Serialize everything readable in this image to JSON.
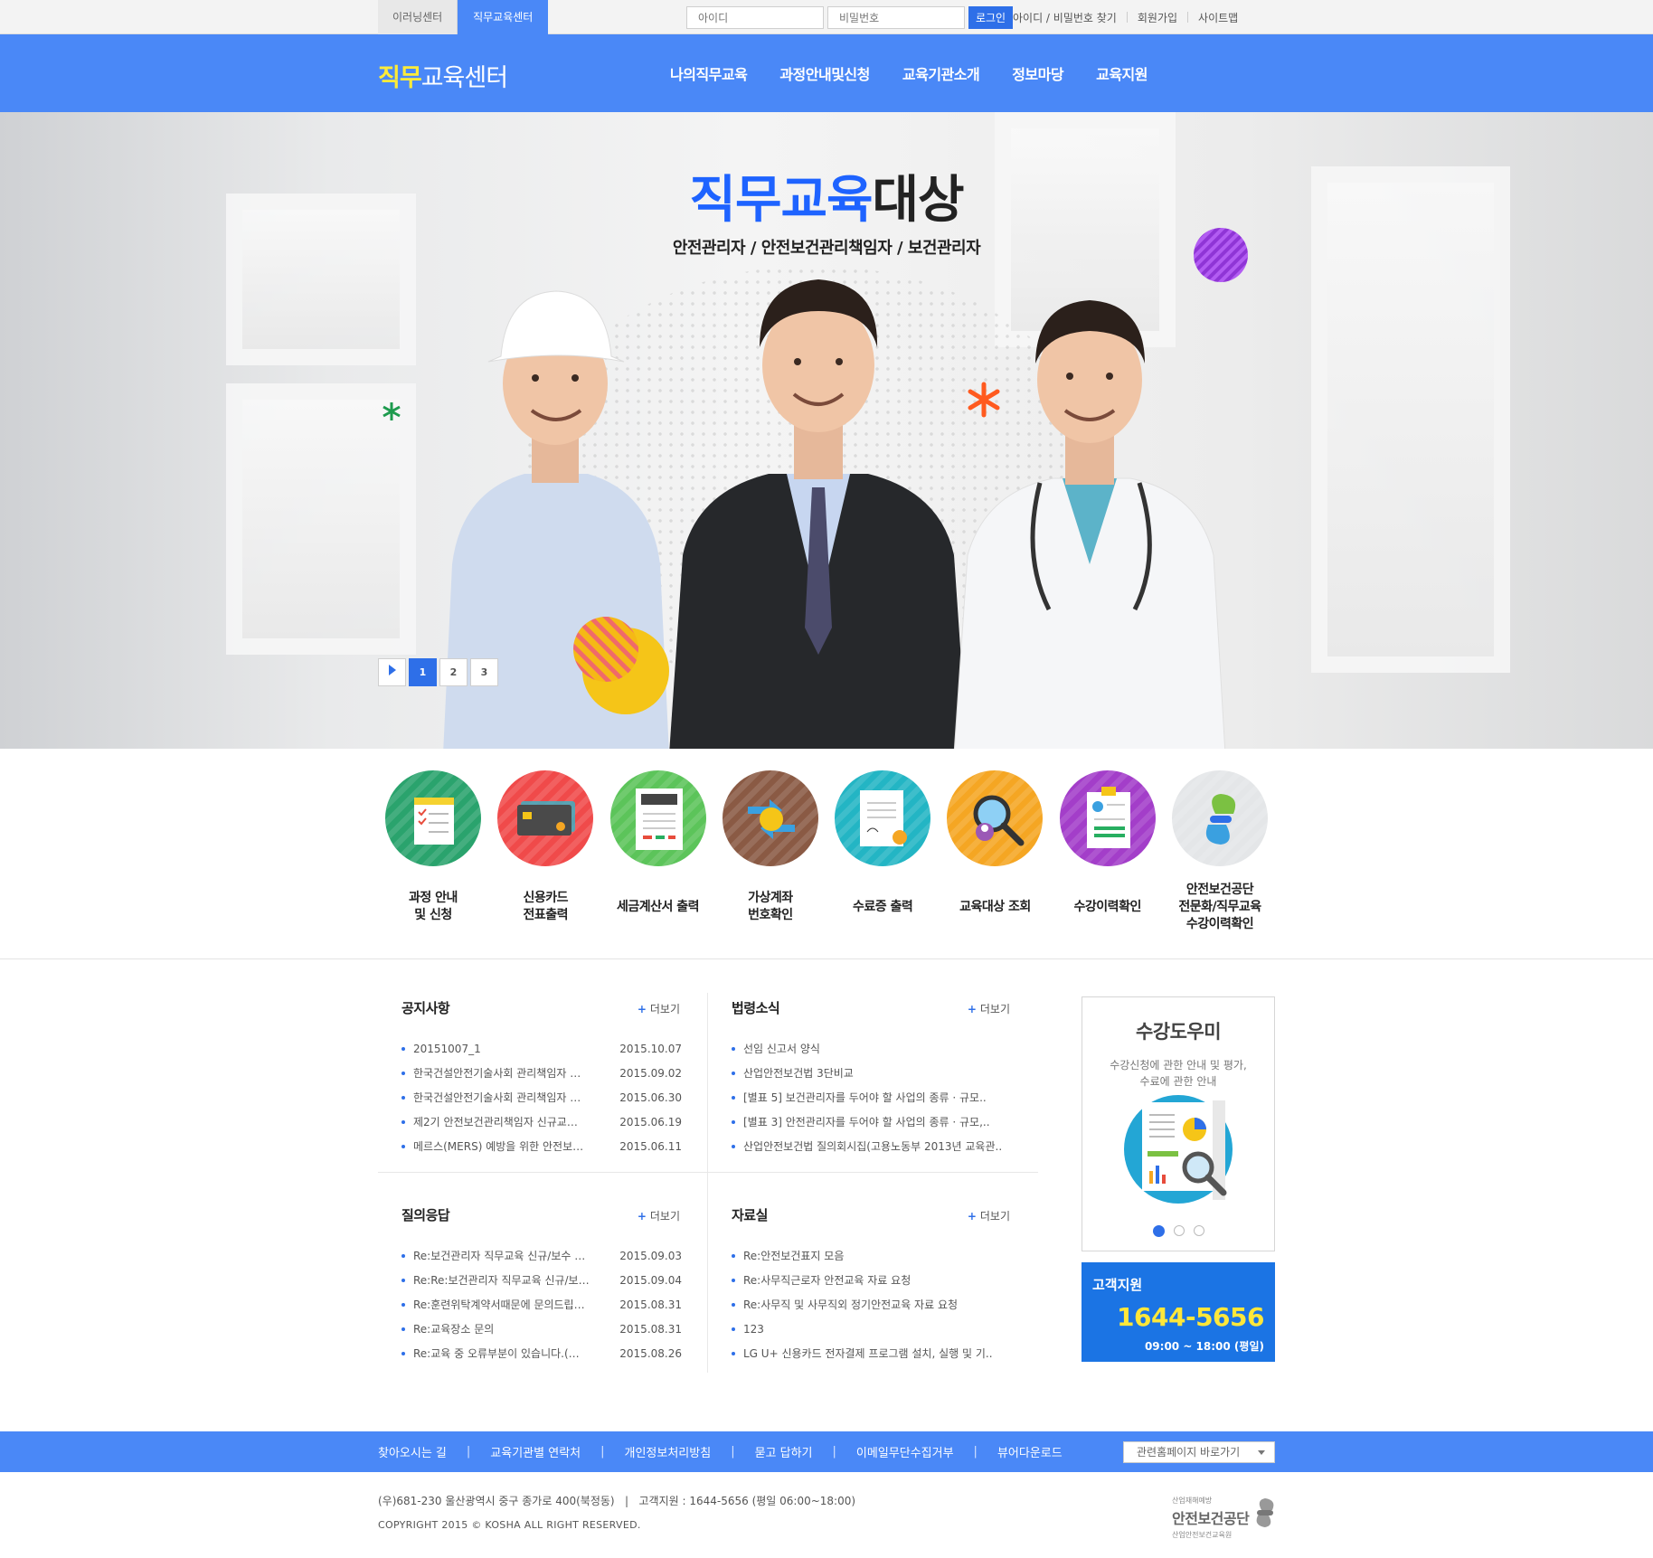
{
  "topbar": {
    "tabs": [
      "이러닝센터",
      "직무교육센터"
    ],
    "id_placeholder": "아이디",
    "pw_placeholder": "비밀번호",
    "login_label": "로그인",
    "links": [
      "아이디 / 비밀번호 찾기",
      "회원가입",
      "사이트맵"
    ]
  },
  "header": {
    "logo_highlight": "직무",
    "logo_rest": "교육센터",
    "nav": [
      "나의직무교육",
      "과정안내및신청",
      "교육기관소개",
      "정보마당",
      "교육지원"
    ],
    "brand_color": "#4a88f7"
  },
  "hero": {
    "title_blue": "직무교육",
    "title_dark": "대상",
    "subtitle": "안전관리자 / 안전보건관리책임자 / 보건관리자",
    "pager": [
      "1",
      "2",
      "3"
    ],
    "active_page": "1"
  },
  "quick_menu": [
    {
      "label": "과정 안내\n및 신청",
      "icon": "calendar-checklist-icon",
      "color": "#2aa36d"
    },
    {
      "label": "신용카드\n전표출력",
      "icon": "credit-card-icon",
      "color": "#f04a4a"
    },
    {
      "label": "세금계산서 출력",
      "icon": "tax-receipt-icon",
      "color": "#5cc45a"
    },
    {
      "label": "가상계좌\n번호확인",
      "icon": "currency-exchange-icon",
      "color": "#8a5a44"
    },
    {
      "label": "수료증 출력",
      "icon": "certificate-icon",
      "color": "#23b5c4"
    },
    {
      "label": "교육대상 조회",
      "icon": "search-person-icon",
      "color": "#f5a623"
    },
    {
      "label": "수강이력확인",
      "icon": "clipboard-icon",
      "color": "#a33ec9"
    },
    {
      "label": "안전보건공단\n전문화/직무교육\n수강이력확인",
      "icon": "kosha-cross-icon",
      "color": "#e4e6e8"
    }
  ],
  "boards": {
    "notice": {
      "title": "공지사항",
      "more": "더보기",
      "items": [
        {
          "t": "20151007_1",
          "d": "2015.10.07"
        },
        {
          "t": "한국건설안전기술사회 관리책임자 …",
          "d": "2015.09.02"
        },
        {
          "t": "한국건설안전기술사회 관리책임자 …",
          "d": "2015.06.30"
        },
        {
          "t": "제2기 안전보건관리책임자 신규교…",
          "d": "2015.06.19"
        },
        {
          "t": "메르스(MERS) 예방을 위한 안전보…",
          "d": "2015.06.11"
        }
      ]
    },
    "law": {
      "title": "법령소식",
      "more": "더보기",
      "items": [
        "선임 신고서 양식",
        "산업안전보건법 3단비교",
        "[별표 5] 보건관리자를 두어야 할 사업의 종류 · 규모..",
        "[별표 3] 안전관리자를 두어야 할 사업의 종류 · 규모,..",
        "산업안전보건법 질의회시집(고용노동부 2013년 교육관.."
      ]
    },
    "qna": {
      "title": "질의응답",
      "more": "더보기",
      "items": [
        {
          "t": "Re:보건관리자 직무교육 신규/보수 …",
          "d": "2015.09.03"
        },
        {
          "t": "Re:Re:보건관리자 직무교육 신규/보…",
          "d": "2015.09.04"
        },
        {
          "t": "Re:훈련위탁계약서때문에 문의드립…",
          "d": "2015.08.31"
        },
        {
          "t": "Re:교육장소 문의",
          "d": "2015.08.31"
        },
        {
          "t": "Re:교육 중 오류부분이 있습니다.(…",
          "d": "2015.08.26"
        }
      ]
    },
    "archive": {
      "title": "자료실",
      "more": "더보기",
      "items": [
        "Re:안전보건표지 모음",
        "Re:사무직근로자 안전교육 자료 요청",
        "Re:사무직 및 사무직외 정기안전교육 자료 요청",
        "123",
        "LG U+ 신용카드 전자결제 프로그램 설치, 실행 및 기.."
      ]
    }
  },
  "helper": {
    "title": "수강도우미",
    "desc": "수강신청에 관한 안내 및 평가,\n수료에 관한 안내",
    "dots": 3
  },
  "customer_service": {
    "title": "고객지원",
    "phone": "1644-5656",
    "hours": "09:00 ~ 18:00 (평일)"
  },
  "footer": {
    "links": [
      "찾아오시는 길",
      "교육기관별 연락처",
      "개인정보처리방침",
      "묻고 답하기",
      "이메일무단수집거부",
      "뷰어다운로드"
    ],
    "related_select": "관련홈페이지 바로가기",
    "address": "(우)681-230 울산광역시 중구 종가로 400(북정동)   |   고객지원 : 1644-5656 (평일 06:00~18:00)",
    "copyright": "COPYRIGHT 2015 © KOSHA ALL RIGHT RESERVED.",
    "logo_top": "산업재해예방",
    "logo_main": "안전보건공단",
    "logo_bottom": "산업안전보건교육원"
  }
}
